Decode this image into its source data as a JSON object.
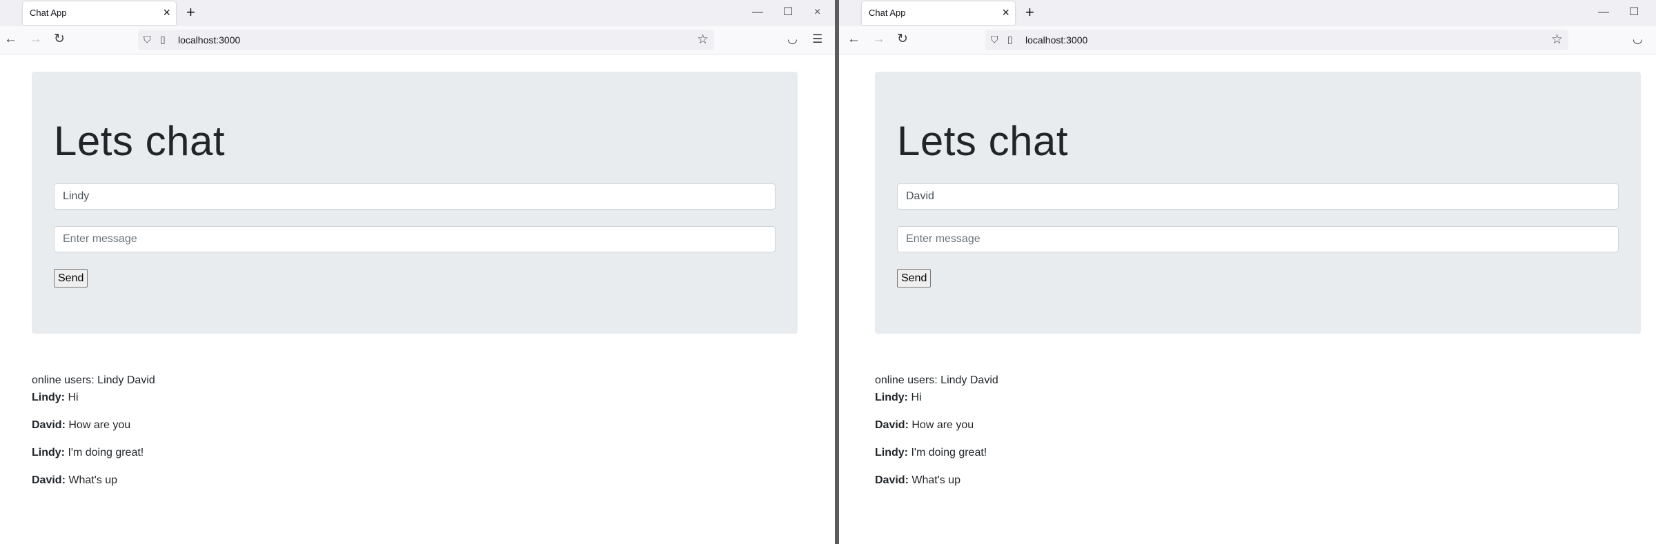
{
  "left": {
    "tab_title": "Chat App",
    "url": "localhost:3000",
    "heading": "Lets chat",
    "name_value": "Lindy",
    "message_placeholder": "Enter message",
    "send_label": "Send",
    "online_label": "online users: Lindy David",
    "messages": [
      {
        "user": "Lindy:",
        "text": "Hi"
      },
      {
        "user": "David:",
        "text": "How are you"
      },
      {
        "user": "Lindy:",
        "text": "I'm doing great!"
      },
      {
        "user": "David:",
        "text": "What's up"
      }
    ]
  },
  "right": {
    "tab_title": "Chat App",
    "url": "localhost:3000",
    "heading": "Lets chat",
    "name_value": "David",
    "message_placeholder": "Enter message",
    "send_label": "Send",
    "online_label": "online users: Lindy David",
    "messages": [
      {
        "user": "Lindy:",
        "text": "Hi"
      },
      {
        "user": "David:",
        "text": "How are you"
      },
      {
        "user": "Lindy:",
        "text": "I'm doing great!"
      },
      {
        "user": "David:",
        "text": "What's up"
      }
    ]
  },
  "icons": {
    "close": "×",
    "new_tab": "+",
    "back": "←",
    "forward": "→",
    "reload": "↻",
    "shield": "⛉",
    "page": "▯",
    "star": "☆",
    "pocket": "◡",
    "menu": "☰",
    "minimize": "—",
    "maximize": "☐"
  }
}
